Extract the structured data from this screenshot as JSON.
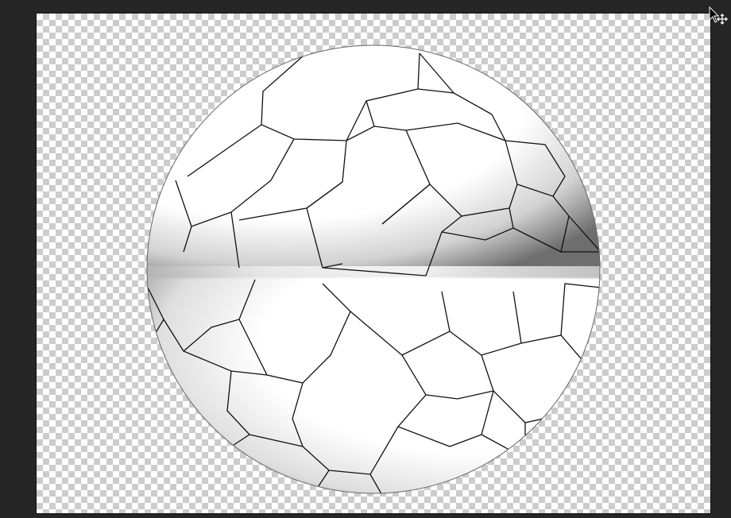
{
  "app": {
    "canvas_background": "transparent-checkerboard",
    "subject": "soccer-ball",
    "cursor": "move-cursor-icon",
    "colors": {
      "workspace": "#262626",
      "checker_light": "#ffffff",
      "checker_dark": "#cccccc",
      "ball_outline": "#111111",
      "shade": "#808080"
    }
  }
}
